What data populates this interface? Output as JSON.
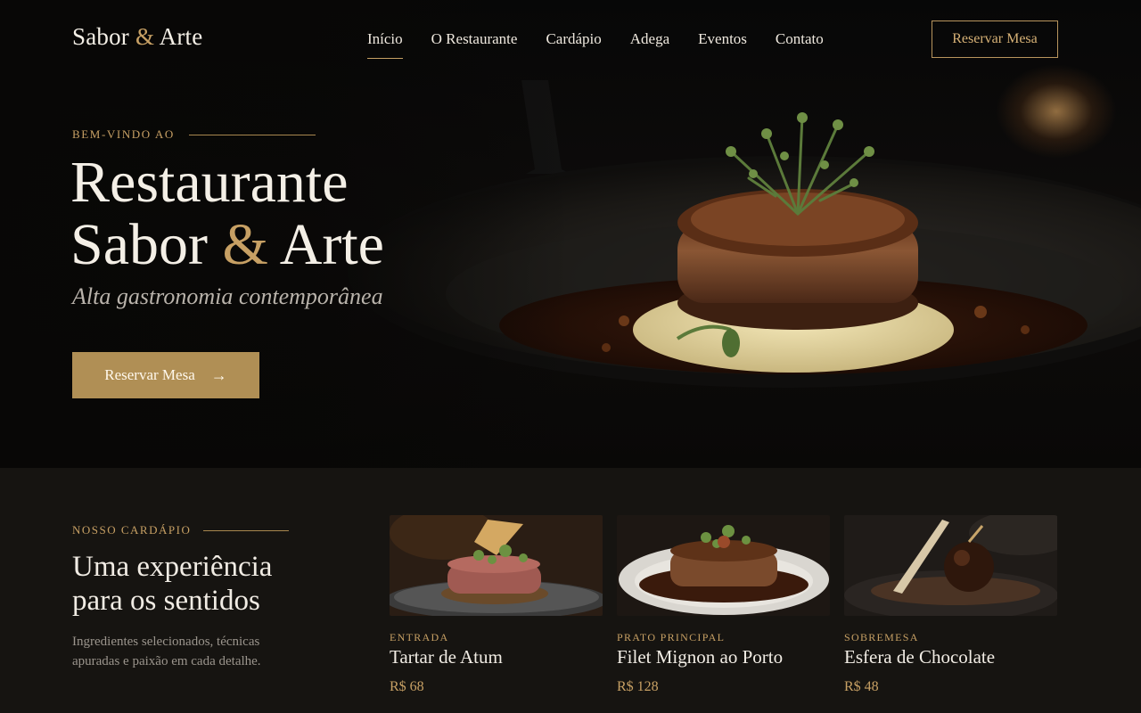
{
  "brand": {
    "name_part1": "Sabor",
    "ampersand": "&",
    "name_part2": "Arte"
  },
  "nav": {
    "items": [
      {
        "label": "Início",
        "active": true
      },
      {
        "label": "O Restaurante"
      },
      {
        "label": "Cardápio"
      },
      {
        "label": "Adega"
      },
      {
        "label": "Eventos"
      },
      {
        "label": "Contato"
      }
    ],
    "cta_label": "Reservar Mesa"
  },
  "hero": {
    "eyebrow": "BEM-VINDO AO",
    "title_line1": "Restaurante",
    "title_line2_part1": "Sabor",
    "title_line2_amp": "&",
    "title_line2_part2": "Arte",
    "subtitle": "Alta gastronomia contemporânea",
    "cta_label": "Reservar Mesa",
    "cta_icon": "arrow-right-icon"
  },
  "menu": {
    "eyebrow": "NOSSO CARDÁPIO",
    "heading_line1": "Uma experiência",
    "heading_line2": "para os sentidos",
    "description": "Ingredientes selecionados, técnicas apuradas e paixão em cada detalhe.",
    "cards": [
      {
        "category": "ENTRADA",
        "name": "Tartar de Atum",
        "price": "R$ 68"
      },
      {
        "category": "PRATO PRINCIPAL",
        "name": "Filet Mignon ao Porto",
        "price": "R$ 128"
      },
      {
        "category": "SOBREMESA",
        "name": "Esfera de Chocolate",
        "price": "R$ 48"
      }
    ]
  },
  "colors": {
    "accent": "#c7a064",
    "button_fill": "#b08f55",
    "hero_bg": "#0b0a09",
    "section_bg": "#161411"
  }
}
